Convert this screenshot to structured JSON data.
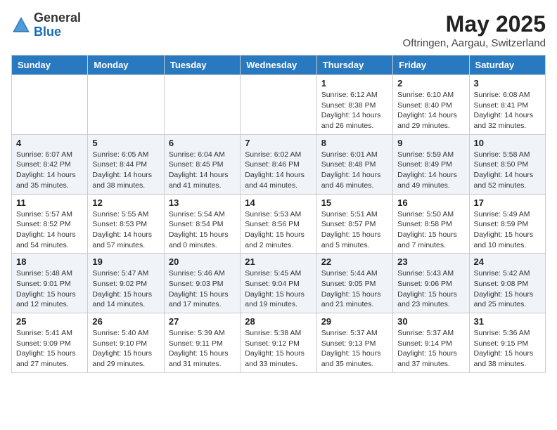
{
  "header": {
    "logo_line1": "General",
    "logo_line2": "Blue",
    "month": "May 2025",
    "location": "Oftringen, Aargau, Switzerland"
  },
  "days_of_week": [
    "Sunday",
    "Monday",
    "Tuesday",
    "Wednesday",
    "Thursday",
    "Friday",
    "Saturday"
  ],
  "weeks": [
    [
      {
        "day": "",
        "info": ""
      },
      {
        "day": "",
        "info": ""
      },
      {
        "day": "",
        "info": ""
      },
      {
        "day": "",
        "info": ""
      },
      {
        "day": "1",
        "sunrise": "6:12 AM",
        "sunset": "8:38 PM",
        "daylight": "14 hours and 26 minutes."
      },
      {
        "day": "2",
        "sunrise": "6:10 AM",
        "sunset": "8:40 PM",
        "daylight": "14 hours and 29 minutes."
      },
      {
        "day": "3",
        "sunrise": "6:08 AM",
        "sunset": "8:41 PM",
        "daylight": "14 hours and 32 minutes."
      }
    ],
    [
      {
        "day": "4",
        "sunrise": "6:07 AM",
        "sunset": "8:42 PM",
        "daylight": "14 hours and 35 minutes."
      },
      {
        "day": "5",
        "sunrise": "6:05 AM",
        "sunset": "8:44 PM",
        "daylight": "14 hours and 38 minutes."
      },
      {
        "day": "6",
        "sunrise": "6:04 AM",
        "sunset": "8:45 PM",
        "daylight": "14 hours and 41 minutes."
      },
      {
        "day": "7",
        "sunrise": "6:02 AM",
        "sunset": "8:46 PM",
        "daylight": "14 hours and 44 minutes."
      },
      {
        "day": "8",
        "sunrise": "6:01 AM",
        "sunset": "8:48 PM",
        "daylight": "14 hours and 46 minutes."
      },
      {
        "day": "9",
        "sunrise": "5:59 AM",
        "sunset": "8:49 PM",
        "daylight": "14 hours and 49 minutes."
      },
      {
        "day": "10",
        "sunrise": "5:58 AM",
        "sunset": "8:50 PM",
        "daylight": "14 hours and 52 minutes."
      }
    ],
    [
      {
        "day": "11",
        "sunrise": "5:57 AM",
        "sunset": "8:52 PM",
        "daylight": "14 hours and 54 minutes."
      },
      {
        "day": "12",
        "sunrise": "5:55 AM",
        "sunset": "8:53 PM",
        "daylight": "14 hours and 57 minutes."
      },
      {
        "day": "13",
        "sunrise": "5:54 AM",
        "sunset": "8:54 PM",
        "daylight": "15 hours and 0 minutes."
      },
      {
        "day": "14",
        "sunrise": "5:53 AM",
        "sunset": "8:56 PM",
        "daylight": "15 hours and 2 minutes."
      },
      {
        "day": "15",
        "sunrise": "5:51 AM",
        "sunset": "8:57 PM",
        "daylight": "15 hours and 5 minutes."
      },
      {
        "day": "16",
        "sunrise": "5:50 AM",
        "sunset": "8:58 PM",
        "daylight": "15 hours and 7 minutes."
      },
      {
        "day": "17",
        "sunrise": "5:49 AM",
        "sunset": "8:59 PM",
        "daylight": "15 hours and 10 minutes."
      }
    ],
    [
      {
        "day": "18",
        "sunrise": "5:48 AM",
        "sunset": "9:01 PM",
        "daylight": "15 hours and 12 minutes."
      },
      {
        "day": "19",
        "sunrise": "5:47 AM",
        "sunset": "9:02 PM",
        "daylight": "15 hours and 14 minutes."
      },
      {
        "day": "20",
        "sunrise": "5:46 AM",
        "sunset": "9:03 PM",
        "daylight": "15 hours and 17 minutes."
      },
      {
        "day": "21",
        "sunrise": "5:45 AM",
        "sunset": "9:04 PM",
        "daylight": "15 hours and 19 minutes."
      },
      {
        "day": "22",
        "sunrise": "5:44 AM",
        "sunset": "9:05 PM",
        "daylight": "15 hours and 21 minutes."
      },
      {
        "day": "23",
        "sunrise": "5:43 AM",
        "sunset": "9:06 PM",
        "daylight": "15 hours and 23 minutes."
      },
      {
        "day": "24",
        "sunrise": "5:42 AM",
        "sunset": "9:08 PM",
        "daylight": "15 hours and 25 minutes."
      }
    ],
    [
      {
        "day": "25",
        "sunrise": "5:41 AM",
        "sunset": "9:09 PM",
        "daylight": "15 hours and 27 minutes."
      },
      {
        "day": "26",
        "sunrise": "5:40 AM",
        "sunset": "9:10 PM",
        "daylight": "15 hours and 29 minutes."
      },
      {
        "day": "27",
        "sunrise": "5:39 AM",
        "sunset": "9:11 PM",
        "daylight": "15 hours and 31 minutes."
      },
      {
        "day": "28",
        "sunrise": "5:38 AM",
        "sunset": "9:12 PM",
        "daylight": "15 hours and 33 minutes."
      },
      {
        "day": "29",
        "sunrise": "5:37 AM",
        "sunset": "9:13 PM",
        "daylight": "15 hours and 35 minutes."
      },
      {
        "day": "30",
        "sunrise": "5:37 AM",
        "sunset": "9:14 PM",
        "daylight": "15 hours and 37 minutes."
      },
      {
        "day": "31",
        "sunrise": "5:36 AM",
        "sunset": "9:15 PM",
        "daylight": "15 hours and 38 minutes."
      }
    ]
  ]
}
